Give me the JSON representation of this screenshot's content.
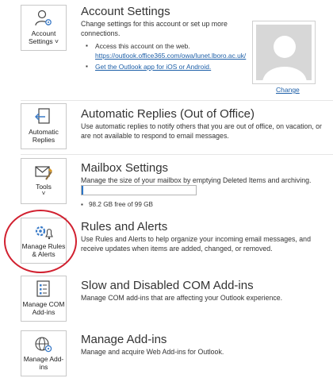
{
  "account": {
    "tile_label": "Account Settings ˅",
    "title": "Account Settings",
    "description": "Change settings for this account or set up more connections.",
    "bullet_access": "Access this account on the web.",
    "web_link": "https://outlook.office365.com/owa/lunet.lboro.ac.uk/",
    "app_link": "Get the Outlook app for iOS or Android.",
    "change_photo": "Change"
  },
  "automatic_replies": {
    "tile_label": "Automatic Replies",
    "title": "Automatic Replies (Out of Office)",
    "description": "Use automatic replies to notify others that you are out of office, on vacation, or are not available to respond to email messages."
  },
  "mailbox": {
    "tile_label": "Tools",
    "tile_chevron": "˅",
    "title": "Mailbox Settings",
    "description": "Manage the size of your mailbox by emptying Deleted Items and archiving.",
    "storage_text": "98.2 GB free of 99 GB",
    "used_fraction": 0.0081,
    "progress_color": "#2b74c6"
  },
  "rules": {
    "tile_label": "Manage Rules & Alerts",
    "title": "Rules and Alerts",
    "description": "Use Rules and Alerts to help organize your incoming email messages, and receive updates when items are added, changed, or removed.",
    "highlight_color": "#d1202f"
  },
  "com_addins": {
    "tile_label": "Manage COM Add-ins",
    "title": "Slow and Disabled COM Add-ins",
    "description": "Manage COM add-ins that are affecting your Outlook experience."
  },
  "addins": {
    "tile_label": "Manage Add-ins",
    "title": "Manage Add-ins",
    "description": "Manage and acquire Web Add-ins for Outlook."
  },
  "colors": {
    "link": "#1d5fa8",
    "icon_blue": "#3a7bc8",
    "icon_dark": "#444444"
  }
}
